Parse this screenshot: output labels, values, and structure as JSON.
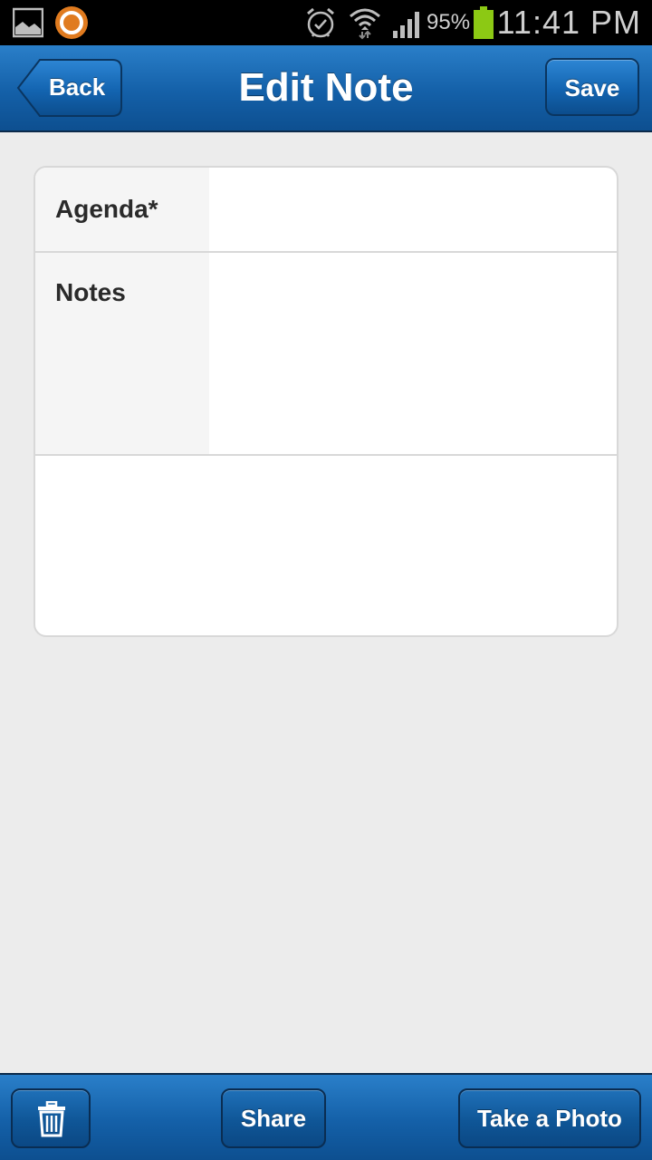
{
  "status_bar": {
    "icons": [
      "gallery-icon",
      "app-notification-icon",
      "alarm-icon",
      "wifi-icon",
      "signal-icon",
      "battery-icon"
    ],
    "battery_percent": "95%",
    "time": "11:41 PM",
    "battery_color": "#8cc914"
  },
  "nav": {
    "back_label": "Back",
    "title": "Edit Note",
    "save_label": "Save",
    "accent_color": "#1767b3"
  },
  "form": {
    "agenda_label": "Agenda*",
    "agenda_value": "",
    "notes_label": "Notes",
    "notes_value": ""
  },
  "toolbar": {
    "delete_icon": "trash-icon",
    "share_label": "Share",
    "photo_label": "Take a Photo"
  }
}
